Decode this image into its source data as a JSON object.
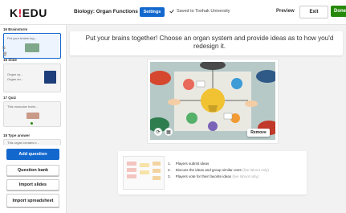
{
  "header": {
    "logo": "K!EDU",
    "title": "Biology: Organ Functions (Basic)",
    "settings_label": "Settings",
    "saved_text": "Saved to Toohak University",
    "preview_label": "Preview",
    "exit_label": "Exit",
    "done_label": "Done"
  },
  "sidebar": {
    "slides": [
      {
        "label": "16 Brainstorm",
        "text": "Put your brains tog..."
      },
      {
        "label": "16 Slide",
        "text1": "Organ sy...",
        "text2": "Organ an..."
      },
      {
        "label": "17 Quiz",
        "text": "This muscular hube..."
      },
      {
        "label": "18 Type answer",
        "text": "This organ creates b..."
      }
    ],
    "add_question": "Add question",
    "question_bank": "Question bank",
    "import_slides": "Import slides",
    "import_spreadsheet": "Import spreadsheet"
  },
  "main": {
    "question": "Put your brains together! Choose an organ system and provide ideas as to how you'd redesign it.",
    "remove_label": "Remove",
    "steps": [
      {
        "num": "1.",
        "text": "Players submit ideas",
        "note": ""
      },
      {
        "num": "2.",
        "text": "Discuss the ideas and group similar ones",
        "note": "(live lahoot only)"
      },
      {
        "num": "3.",
        "text": "Players vote for their favorite ideas",
        "note": "(live lahoot only)"
      }
    ]
  },
  "colors": {
    "brand_blue": "#1368ce",
    "done_green": "#26890c",
    "logo_red": "#e21b3c"
  }
}
